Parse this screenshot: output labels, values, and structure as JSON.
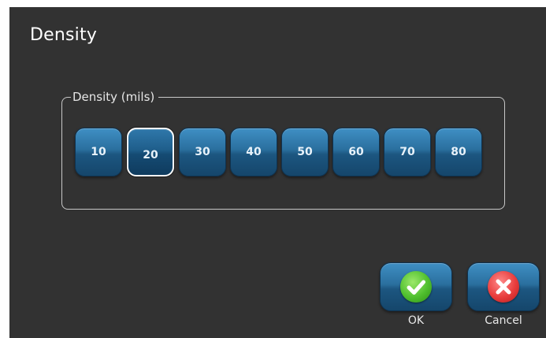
{
  "dialog": {
    "title": "Density",
    "group_label": "Density (mils)",
    "options": [
      "10",
      "20",
      "30",
      "40",
      "50",
      "60",
      "70",
      "80"
    ],
    "selected": "20"
  },
  "actions": {
    "ok_label": "OK",
    "cancel_label": "Cancel",
    "ok_icon": "check-icon",
    "cancel_icon": "x-icon"
  },
  "colors": {
    "background": "#323232",
    "button_blue": "#2a6f9e",
    "ok_green": "#4fbf2e",
    "cancel_red": "#e83c3c"
  }
}
